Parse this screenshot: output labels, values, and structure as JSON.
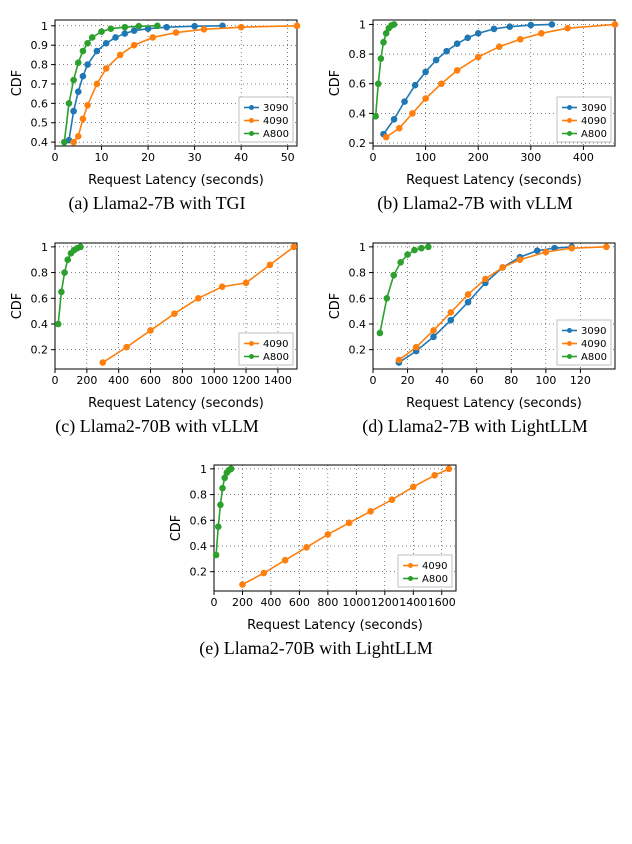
{
  "colors": {
    "3090": "#1f77b4",
    "4090": "#ff7f0e",
    "A800": "#2ca02c"
  },
  "chart_data": [
    {
      "id": "a",
      "caption": "(a) Llama2-7B with TGI",
      "type": "line",
      "xlabel": "Request Latency (seconds)",
      "ylabel": "CDF",
      "xlim": [
        0,
        52
      ],
      "xticks": [
        0,
        10,
        20,
        30,
        40,
        50
      ],
      "ylim": [
        0.38,
        1.03
      ],
      "yticks": [
        0.4,
        0.5,
        0.6,
        0.7,
        0.8,
        0.9,
        1.0
      ],
      "legend_pos": "br",
      "series": [
        {
          "name": "3090",
          "x": [
            3,
            4,
            5,
            6,
            7,
            9,
            11,
            13,
            15,
            17,
            20,
            24,
            30,
            36
          ],
          "y": [
            0.41,
            0.56,
            0.66,
            0.74,
            0.8,
            0.87,
            0.91,
            0.94,
            0.96,
            0.975,
            0.985,
            0.993,
            0.998,
            1.0
          ]
        },
        {
          "name": "4090",
          "x": [
            4,
            5,
            6,
            7,
            9,
            11,
            14,
            17,
            21,
            26,
            32,
            40,
            52
          ],
          "y": [
            0.4,
            0.43,
            0.52,
            0.59,
            0.7,
            0.78,
            0.85,
            0.9,
            0.94,
            0.965,
            0.982,
            0.993,
            1.0
          ]
        },
        {
          "name": "A800",
          "x": [
            2,
            3,
            4,
            5,
            6,
            7,
            8,
            10,
            12,
            15,
            18,
            22
          ],
          "y": [
            0.4,
            0.6,
            0.72,
            0.81,
            0.87,
            0.91,
            0.94,
            0.97,
            0.985,
            0.993,
            0.998,
            1.0
          ]
        }
      ]
    },
    {
      "id": "b",
      "caption": "(b) Llama2-7B with vLLM",
      "type": "line",
      "xlabel": "Request Latency (seconds)",
      "ylabel": "CDF",
      "xlim": [
        0,
        460
      ],
      "xticks": [
        0,
        100,
        200,
        300,
        400
      ],
      "ylim": [
        0.18,
        1.03
      ],
      "yticks": [
        0.2,
        0.4,
        0.6,
        0.8,
        1.0
      ],
      "legend_pos": "br",
      "series": [
        {
          "name": "3090",
          "x": [
            20,
            40,
            60,
            80,
            100,
            120,
            140,
            160,
            180,
            200,
            230,
            260,
            300,
            340
          ],
          "y": [
            0.26,
            0.36,
            0.48,
            0.59,
            0.68,
            0.76,
            0.82,
            0.87,
            0.91,
            0.94,
            0.97,
            0.985,
            0.996,
            1.0
          ]
        },
        {
          "name": "4090",
          "x": [
            25,
            50,
            75,
            100,
            130,
            160,
            200,
            240,
            280,
            320,
            370,
            460
          ],
          "y": [
            0.24,
            0.3,
            0.4,
            0.5,
            0.6,
            0.69,
            0.78,
            0.85,
            0.9,
            0.94,
            0.975,
            1.0
          ]
        },
        {
          "name": "A800",
          "x": [
            5,
            10,
            15,
            20,
            25,
            30,
            35,
            40
          ],
          "y": [
            0.38,
            0.6,
            0.77,
            0.88,
            0.94,
            0.975,
            0.993,
            1.0
          ]
        }
      ]
    },
    {
      "id": "c",
      "caption": "(c) Llama2-70B with vLLM",
      "type": "line",
      "xlabel": "Request Latency (seconds)",
      "ylabel": "CDF",
      "xlim": [
        0,
        1520
      ],
      "xticks": [
        0,
        200,
        400,
        600,
        800,
        1000,
        1200,
        1400
      ],
      "ylim": [
        0.05,
        1.03
      ],
      "yticks": [
        0.2,
        0.4,
        0.6,
        0.8,
        1.0
      ],
      "legend_pos": "br",
      "series": [
        {
          "name": "4090",
          "x": [
            300,
            450,
            600,
            750,
            900,
            1050,
            1200,
            1350,
            1500
          ],
          "y": [
            0.1,
            0.22,
            0.35,
            0.48,
            0.6,
            0.69,
            0.72,
            0.86,
            1.0
          ]
        },
        {
          "name": "A800",
          "x": [
            20,
            40,
            60,
            80,
            100,
            120,
            140,
            160
          ],
          "y": [
            0.4,
            0.65,
            0.8,
            0.9,
            0.95,
            0.975,
            0.99,
            1.0
          ]
        }
      ]
    },
    {
      "id": "d",
      "caption": "(d) Llama2-7B with LightLLM",
      "type": "line",
      "xlabel": "Request Latency (seconds)",
      "ylabel": "CDF",
      "xlim": [
        0,
        140
      ],
      "xticks": [
        0,
        20,
        40,
        60,
        80,
        100,
        120
      ],
      "ylim": [
        0.05,
        1.03
      ],
      "yticks": [
        0.2,
        0.4,
        0.6,
        0.8,
        1.0
      ],
      "legend_pos": "br",
      "series": [
        {
          "name": "3090",
          "x": [
            15,
            25,
            35,
            45,
            55,
            65,
            75,
            85,
            95,
            105,
            115
          ],
          "y": [
            0.1,
            0.19,
            0.3,
            0.43,
            0.57,
            0.72,
            0.84,
            0.92,
            0.97,
            0.99,
            1.0
          ]
        },
        {
          "name": "4090",
          "x": [
            15,
            25,
            35,
            45,
            55,
            65,
            75,
            85,
            100,
            115,
            135
          ],
          "y": [
            0.12,
            0.22,
            0.35,
            0.49,
            0.63,
            0.75,
            0.84,
            0.9,
            0.96,
            0.99,
            1.0
          ]
        },
        {
          "name": "A800",
          "x": [
            4,
            8,
            12,
            16,
            20,
            24,
            28,
            32
          ],
          "y": [
            0.33,
            0.6,
            0.78,
            0.88,
            0.94,
            0.975,
            0.99,
            1.0
          ]
        }
      ]
    },
    {
      "id": "e",
      "caption": "(e) Llama2-70B with LightLLM",
      "type": "line",
      "xlabel": "Request Latency (seconds)",
      "ylabel": "CDF",
      "xlim": [
        0,
        1700
      ],
      "xticks": [
        0,
        200,
        400,
        600,
        800,
        1000,
        1200,
        1400,
        1600
      ],
      "ylim": [
        0.05,
        1.03
      ],
      "yticks": [
        0.2,
        0.4,
        0.6,
        0.8,
        1.0
      ],
      "legend_pos": "br",
      "series": [
        {
          "name": "4090",
          "x": [
            200,
            350,
            500,
            650,
            800,
            950,
            1100,
            1250,
            1400,
            1550,
            1650
          ],
          "y": [
            0.1,
            0.19,
            0.29,
            0.39,
            0.49,
            0.58,
            0.67,
            0.76,
            0.86,
            0.95,
            1.0
          ]
        },
        {
          "name": "A800",
          "x": [
            15,
            30,
            45,
            60,
            75,
            90,
            105,
            120
          ],
          "y": [
            0.33,
            0.55,
            0.72,
            0.85,
            0.93,
            0.97,
            0.99,
            1.0
          ]
        }
      ]
    }
  ]
}
